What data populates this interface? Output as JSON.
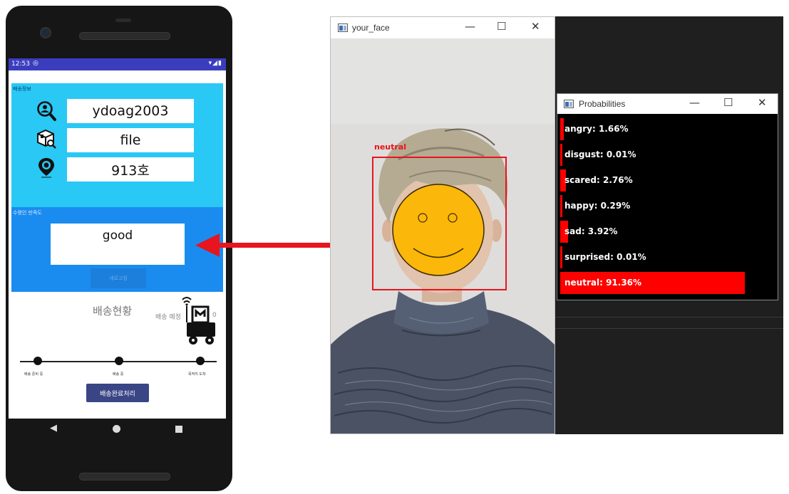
{
  "phone": {
    "status_time": "12:53",
    "status_icons": "▾◢▮",
    "info_panel": {
      "title": "배송정보",
      "user_id": "ydoag2003",
      "item": "file",
      "location": "913호"
    },
    "satisfaction_panel": {
      "title": "수령인 만족도",
      "value": "good",
      "refresh_button": "새로고침"
    },
    "delivery": {
      "title": "배송현황",
      "eta_label": "배송 예정",
      "eta_value": "0",
      "steps": [
        "배송 준비 중",
        "배송 중",
        "목적지 도착"
      ],
      "complete_button": "배송완료처리"
    }
  },
  "face_window": {
    "title": "your_face",
    "detection_label": "neutral",
    "box_color": "#e8141e",
    "emoji_color": "#fbb70a"
  },
  "prob_window": {
    "title": "Probabilities",
    "bar_color": "#ff0000",
    "items": [
      {
        "label": "angry: 1.66%",
        "value": 1.66
      },
      {
        "label": "disgust: 0.01%",
        "value": 0.01
      },
      {
        "label": "scared: 2.76%",
        "value": 2.76
      },
      {
        "label": "happy: 0.29%",
        "value": 0.29
      },
      {
        "label": "sad: 3.92%",
        "value": 3.92
      },
      {
        "label": "surprised: 0.01%",
        "value": 0.01
      },
      {
        "label": "neutral: 91.36%",
        "value": 91.36
      }
    ]
  },
  "icons": {
    "window_controls": [
      "minimize-icon",
      "maximize-icon",
      "close-icon"
    ],
    "minimize": "—",
    "maximize": "☐",
    "close": "✕"
  }
}
